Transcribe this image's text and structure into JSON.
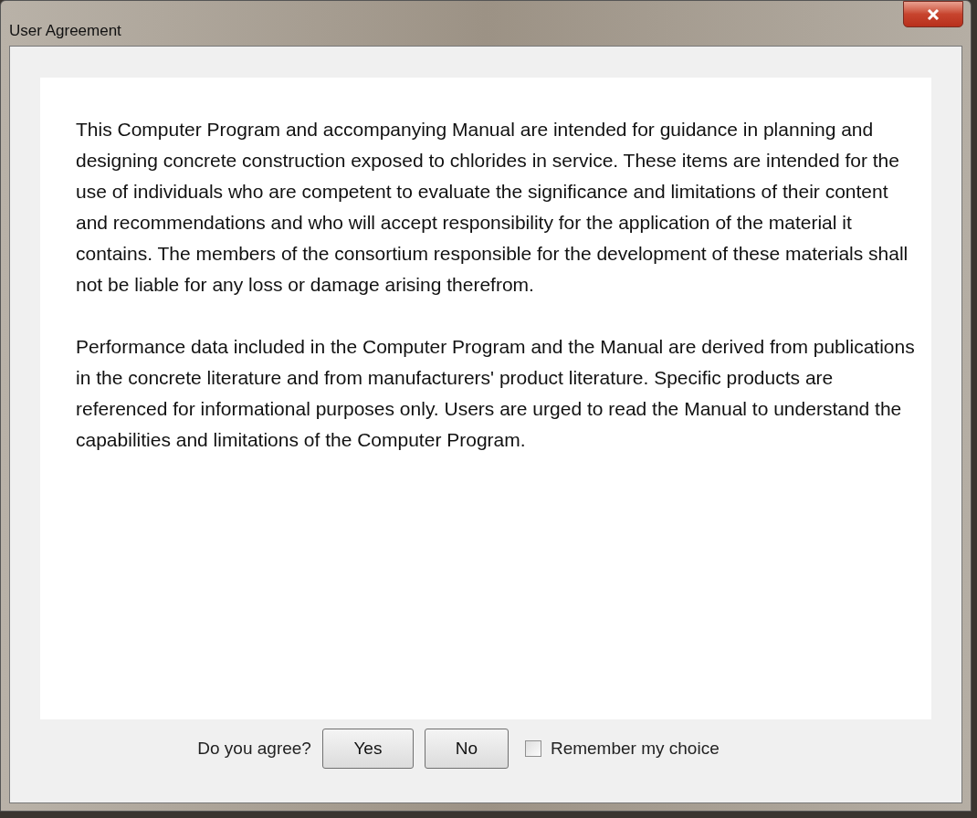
{
  "window": {
    "title": "User Agreement"
  },
  "paragraphs": [
    "This Computer Program and accompanying Manual are intended for guidance in planning and designing concrete construction exposed to chlorides in service. These items are intended for the use of individuals who are competent to evaluate the significance and limitations of their content and recommendations and who will accept responsibility for the application of the material it contains. The members of the consortium responsible for the development of these materials shall not be liable for any loss or damage arising therefrom.",
    "Performance data included in the Computer Program and the Manual are derived from publications in the concrete literature and from manufacturers' product literature. Specific products are referenced for informational purposes only. Users are urged to read the Manual to understand the capabilities and limitations of the Computer Program."
  ],
  "prompt": "Do you agree?",
  "buttons": [
    "Yes",
    "No"
  ],
  "remember": {
    "label": "Remember my choice",
    "checked": false
  }
}
